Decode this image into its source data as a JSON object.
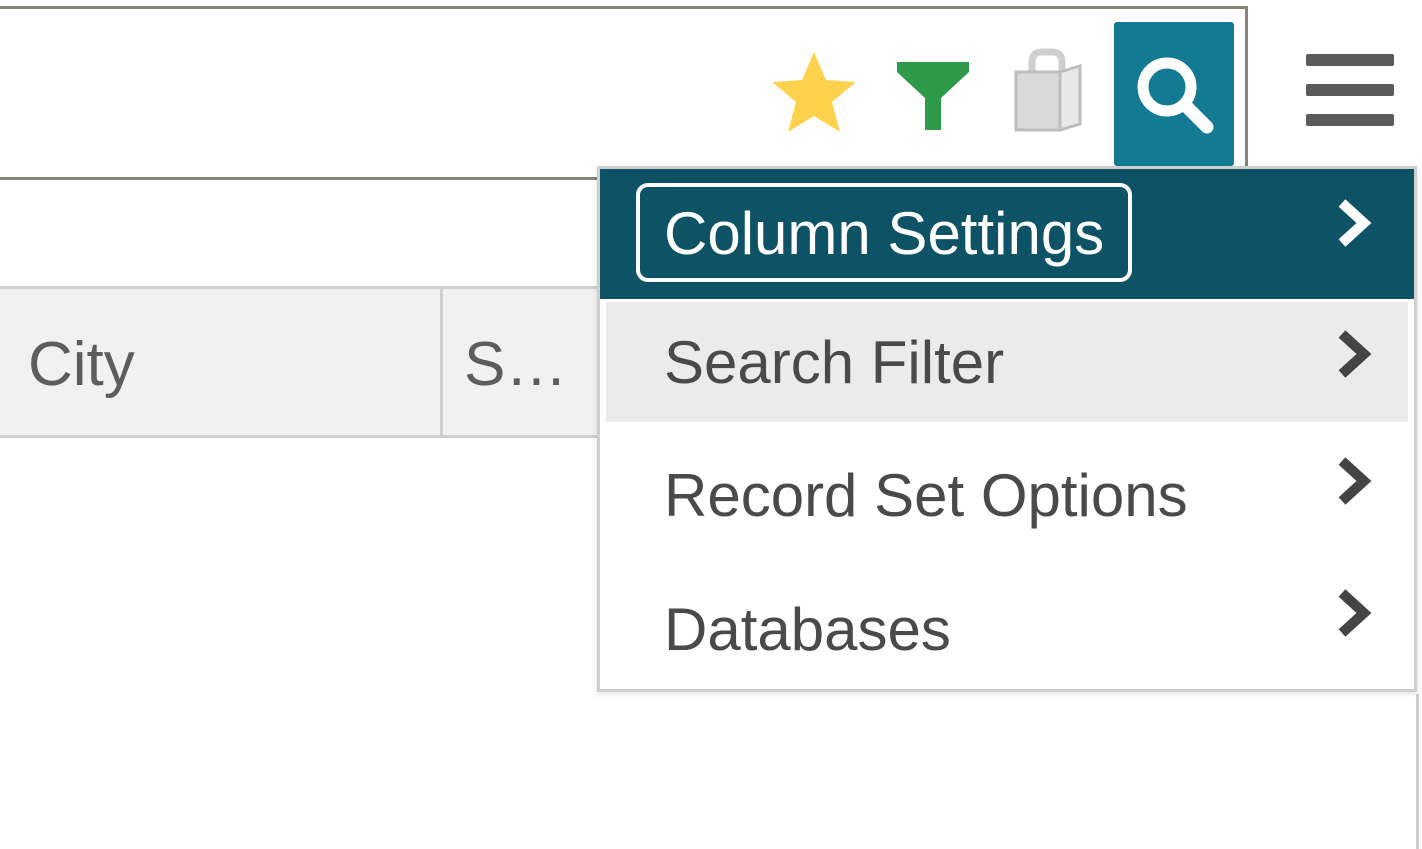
{
  "toolbar": {
    "icons": [
      "star-icon",
      "filter-icon",
      "bag-icon",
      "search-icon",
      "hamburger-menu-icon"
    ]
  },
  "table": {
    "columns": [
      "City",
      "S…"
    ]
  },
  "menu": {
    "items": [
      {
        "label": "Column Settings",
        "state": "focused"
      },
      {
        "label": "Search Filter",
        "state": "hover"
      },
      {
        "label": "Record Set Options",
        "state": "normal"
      },
      {
        "label": "Databases",
        "state": "normal"
      }
    ]
  },
  "colors": {
    "accent": "#137a94",
    "menu_active": "#0e5266",
    "star": "#ffd24d",
    "filter": "#2e9a4a",
    "text": "#4a4a4a"
  }
}
